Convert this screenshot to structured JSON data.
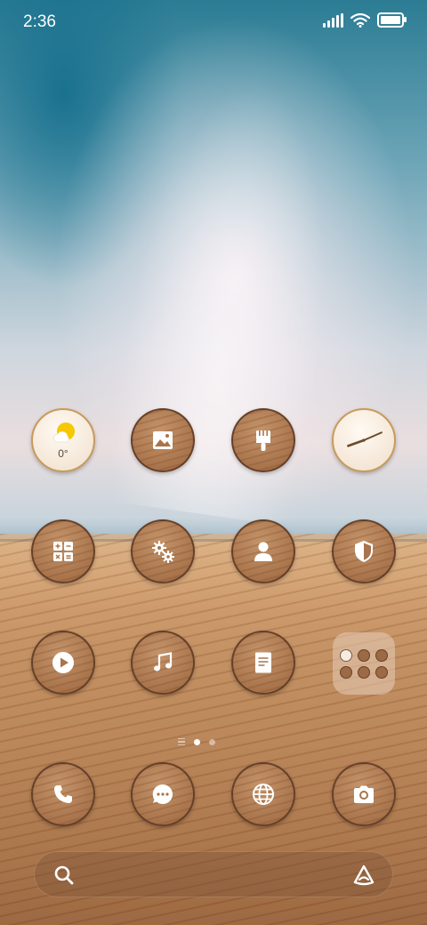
{
  "status_bar": {
    "time": "2:36",
    "icons": [
      "signal-icon",
      "wifi-icon",
      "battery-icon"
    ]
  },
  "home": {
    "rows": [
      [
        "weather-widget",
        "gallery",
        "themes",
        "clock"
      ],
      [
        "calculator",
        "settings",
        "contacts",
        "security"
      ],
      [
        "video",
        "music",
        "notes",
        "folder"
      ]
    ],
    "weather_temp": "0°",
    "page_indicator": {
      "pages": 2,
      "active": 1
    }
  },
  "dock": [
    "phone",
    "messages",
    "browser",
    "camera"
  ],
  "search": {
    "left_icon": "search-icon",
    "right_icon": "assistant-icon"
  },
  "colors": {
    "icon_fill": "#a9744c",
    "light_icon": "#f3e4d3",
    "sun": "#f5c800"
  }
}
